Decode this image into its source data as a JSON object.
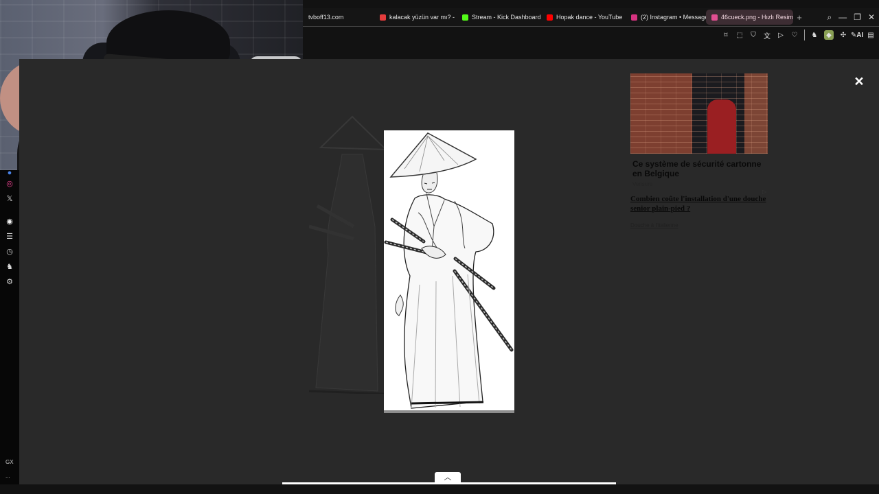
{
  "browser": {
    "tabs": [
      {
        "label": "tvboff13.com",
        "favicon_color": "#151515"
      },
      {
        "label": "kalacak yüzün var mı? - ...",
        "favicon_color": "#e43c3c"
      },
      {
        "label": "Stream - Kick Dashboard",
        "favicon_color": "#53fc18"
      },
      {
        "label": "Hopak dance - YouTube",
        "favicon_color": "#ff0000"
      },
      {
        "label": "(2) Instagram • Message",
        "favicon_color": "#d63380"
      },
      {
        "label": "46cueck.png - Hızlı Resim",
        "favicon_color": "#e24f92"
      }
    ],
    "new_tab": "+",
    "window_controls": [
      "search-icon",
      "minimize-icon",
      "restore-icon",
      "close-icon"
    ],
    "toolbar_icons": [
      "bookmark-icon",
      "screenshot-icon",
      "shield-icon",
      "translate-icon",
      "play-icon",
      "heart-icon",
      "extension-icon",
      "green-extension-icon",
      "puzzle-icon",
      "ai-icon",
      "notes-icon"
    ],
    "toolbar_ai": "AI"
  },
  "sidebar": {
    "icons": [
      "blue-dot-icon",
      "instagram-icon",
      "x-icon",
      "spotify-icon",
      "layers-icon",
      "clock-icon",
      "bunny-icon",
      "settings-icon"
    ],
    "gx_label": "GX",
    "more": "..."
  },
  "advert": {
    "title": "Ce système de sécurité cartonne en Belgique",
    "source": "Verisure",
    "link": "Combien coûte l'installation d'une douche senior plain-pied ?",
    "small_link": "Douche à l'italienne",
    "badge": "▷"
  },
  "viewer": {
    "close": "×",
    "scroll_up": "︿"
  }
}
